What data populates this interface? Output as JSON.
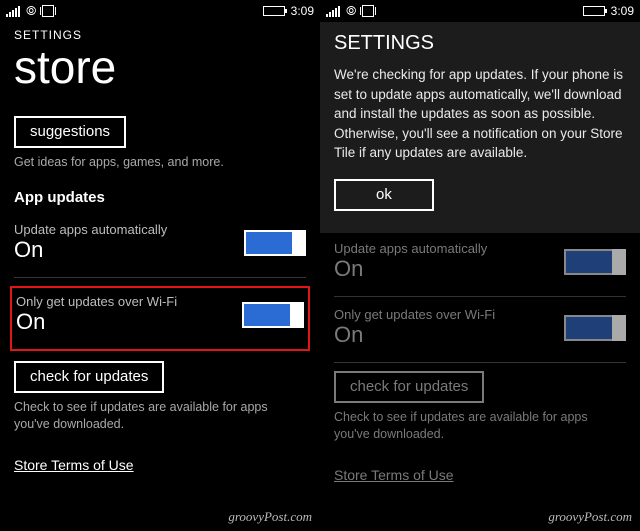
{
  "status": {
    "time": "3:09"
  },
  "watermark": "groovyPost.com",
  "left": {
    "header": "SETTINGS",
    "title": "store",
    "suggestions_btn": "suggestions",
    "suggestions_caption": "Get ideas for apps, games, and more.",
    "section": "App updates",
    "auto_update": {
      "label": "Update apps automatically",
      "value": "On"
    },
    "wifi_only": {
      "label": "Only get updates over Wi-Fi",
      "value": "On"
    },
    "check_btn": "check for updates",
    "check_caption": "Check to see if updates are available for apps you've downloaded.",
    "terms": "Store Terms of Use"
  },
  "right": {
    "dialog": {
      "header": "SETTINGS",
      "body": "We're checking for app updates. If your phone is set to update apps automatically, we'll download and install the updates as soon as possible. Otherwise, you'll see a notification on your Store Tile if any updates are available.",
      "ok": "ok"
    },
    "auto_update": {
      "label": "Update apps automatically",
      "value": "On"
    },
    "wifi_only": {
      "label": "Only get updates over Wi-Fi",
      "value": "On"
    },
    "check_btn": "check for updates",
    "check_caption": "Check to see if updates are available for apps you've downloaded.",
    "terms": "Store Terms of Use"
  }
}
